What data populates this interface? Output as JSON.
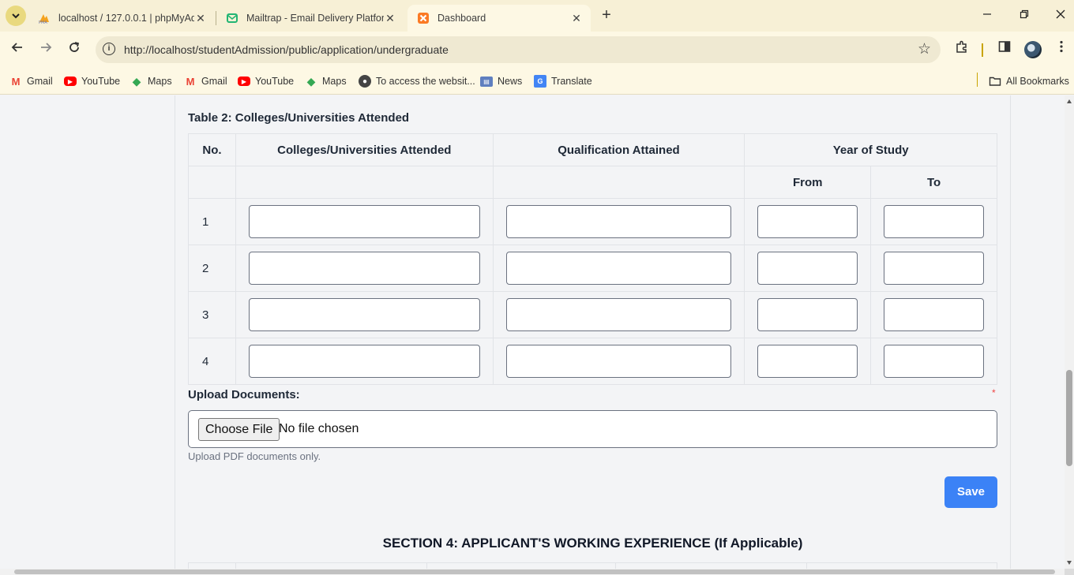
{
  "browser": {
    "tabs": [
      {
        "title": "localhost / 127.0.0.1 | phpMyAdmin",
        "icon": "phpmyadmin-icon",
        "active": false
      },
      {
        "title": "Mailtrap - Email Delivery Platform",
        "icon": "mailtrap-icon",
        "active": false
      },
      {
        "title": "Dashboard",
        "icon": "xampp-icon",
        "active": true
      }
    ],
    "url": "http://localhost/studentAdmission/public/application/undergraduate",
    "bookmarks": [
      {
        "label": "Gmail",
        "icon": "gmail-icon"
      },
      {
        "label": "YouTube",
        "icon": "youtube-icon"
      },
      {
        "label": "Maps",
        "icon": "maps-icon"
      },
      {
        "label": "Gmail",
        "icon": "gmail-icon"
      },
      {
        "label": "YouTube",
        "icon": "youtube-icon"
      },
      {
        "label": "Maps",
        "icon": "maps-icon"
      },
      {
        "label": "To access the websit...",
        "icon": "globe-icon"
      },
      {
        "label": "News",
        "icon": "news-icon"
      },
      {
        "label": "Translate",
        "icon": "translate-icon"
      }
    ],
    "all_bookmarks": "All Bookmarks"
  },
  "form": {
    "table_title": "Table 2: Colleges/Universities Attended",
    "headers": {
      "no": "No.",
      "colleges": "Colleges/Universities Attended",
      "qualification": "Qualification Attained",
      "year": "Year of Study",
      "from": "From",
      "to": "To"
    },
    "rows": [
      "1",
      "2",
      "3",
      "4"
    ],
    "upload_label": "Upload Documents:",
    "required_mark": "*",
    "choose_file": "Choose File",
    "no_file": "No file chosen",
    "upload_hint": "Upload PDF documents only.",
    "save": "Save",
    "section4_title": "SECTION 4: APPLICANT'S WORKING EXPERIENCE (If Applicable)"
  },
  "colors": {
    "accent": "#3b82f6",
    "required": "#ef4444",
    "browser_frame": "#f7f0d6"
  }
}
